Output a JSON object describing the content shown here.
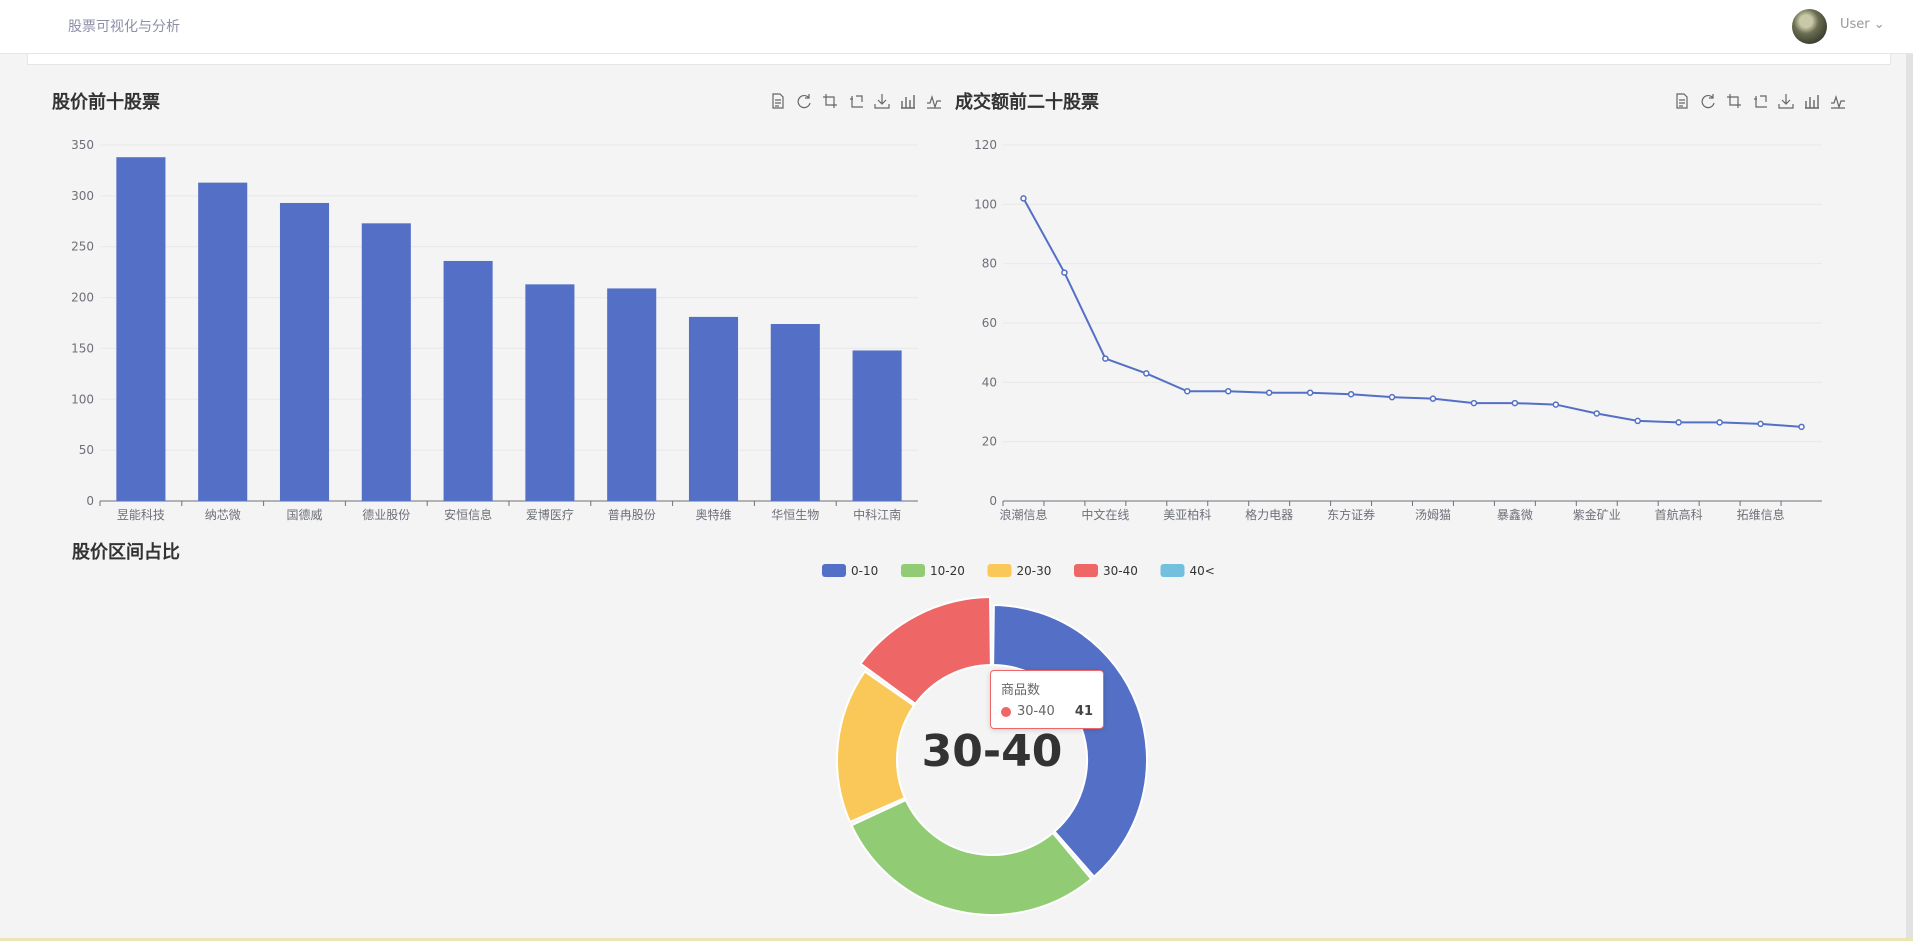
{
  "header": {
    "brand": "股票可视化与分析",
    "user": "User"
  },
  "charts": {
    "top_price": {
      "title": "股价前十股票"
    },
    "top_volume": {
      "title": "成交额前二十股票"
    },
    "price_range": {
      "title": "股价区间占比"
    }
  },
  "toolbox_icons": [
    "data-view-icon",
    "restore-icon",
    "zoom-icon",
    "zoom-reset-icon",
    "save-image-icon",
    "bar-switch-icon",
    "line-switch-icon"
  ],
  "tooltip": {
    "series": "商品数",
    "name": "30-40",
    "value": "41"
  },
  "center_label": "30-40",
  "colors": {
    "primary": "#5470c6",
    "green": "#91cc75",
    "yellow": "#fac858",
    "red": "#ee6666",
    "cyan": "#73c0de"
  },
  "chart_data": [
    {
      "type": "bar",
      "title": "股价前十股票",
      "categories": [
        "昱能科技",
        "纳芯微",
        "国德威",
        "德业股份",
        "安恒信息",
        "爱博医疗",
        "普冉股份",
        "奥特维",
        "华恒生物",
        "中科江南"
      ],
      "values": [
        338,
        313,
        293,
        273,
        236,
        213,
        209,
        181,
        174,
        148
      ],
      "ylim": [
        0,
        350
      ],
      "yticks": [
        0,
        50,
        100,
        150,
        200,
        250,
        300,
        350
      ]
    },
    {
      "type": "line",
      "title": "成交额前二十股票",
      "categories": [
        "浪潮信息",
        "",
        "中文在线",
        "",
        "美亚柏科",
        "",
        "格力电器",
        "",
        "东方证券",
        "",
        "汤姆猫",
        "",
        "暴鑫微",
        "",
        "紫金矿业",
        "",
        "首航高科",
        "",
        "拓维信息",
        ""
      ],
      "values": [
        102,
        77,
        48,
        43,
        37,
        37,
        36.5,
        36.5,
        36,
        35,
        34.5,
        33,
        33,
        32.5,
        29.5,
        27,
        26.5,
        26.5,
        26,
        25
      ],
      "ylim": [
        0,
        120
      ],
      "yticks": [
        0,
        20,
        40,
        60,
        80,
        100,
        120
      ]
    },
    {
      "type": "pie",
      "title": "股价区间占比",
      "categories": [
        "0-10",
        "10-20",
        "20-30",
        "30-40",
        "40<"
      ],
      "values": [
        105,
        80,
        45,
        41,
        0
      ],
      "legend": "top-center"
    }
  ]
}
